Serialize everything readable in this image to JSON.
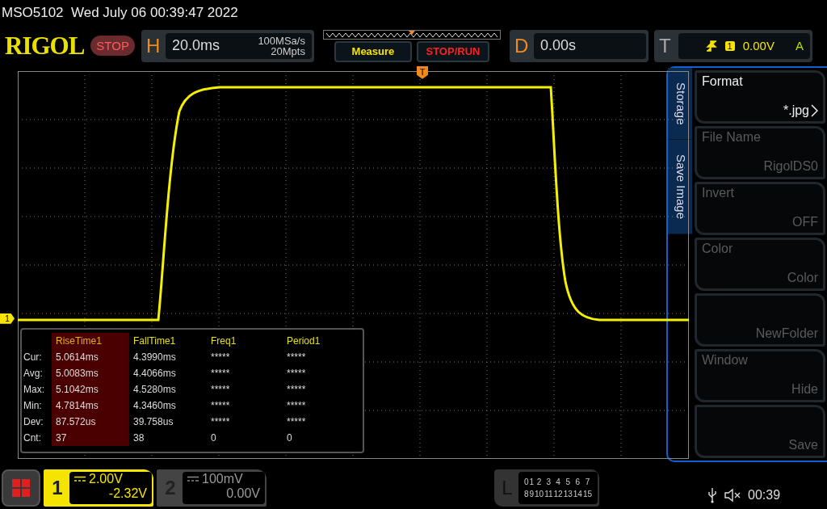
{
  "header": {
    "title": "MSO5102  Wed July 06 00:39:47 2022"
  },
  "toolbar": {
    "logo": "RIGOL",
    "run_state": "STOP",
    "horizontal": {
      "key": "H",
      "timebase": "20.0ms",
      "sample_rate": "100MSa/s",
      "memory_depth": "20Mpts"
    },
    "measure_button": "Measure",
    "stop_run_button": "STOP/RUN",
    "delay": {
      "key": "D",
      "value": "0.00s"
    },
    "trigger": {
      "key": "T",
      "source": "1",
      "level": "0.00V",
      "mode": "A"
    }
  },
  "display": {
    "trigger_marker": "T",
    "channel_marker": "1",
    "measurements": {
      "columns": [
        {
          "name": "RiseTime1",
          "selected": true
        },
        {
          "name": "FallTime1",
          "selected": false
        },
        {
          "name": "Freq1",
          "selected": false
        },
        {
          "name": "Period1",
          "selected": false
        }
      ],
      "rows": [
        {
          "label": "Cur:",
          "values": [
            "5.0614ms",
            "4.3990ms",
            "*****",
            "*****"
          ]
        },
        {
          "label": "Avg:",
          "values": [
            "5.0083ms",
            "4.4066ms",
            "*****",
            "*****"
          ]
        },
        {
          "label": "Max:",
          "values": [
            "5.1042ms",
            "4.5280ms",
            "*****",
            "*****"
          ]
        },
        {
          "label": "Min:",
          "values": [
            "4.7814ms",
            "4.3460ms",
            "*****",
            "*****"
          ]
        },
        {
          "label": "Dev:",
          "values": [
            "87.572us",
            "39.758us",
            "*****",
            "*****"
          ]
        },
        {
          "label": "Cnt:",
          "values": [
            "37",
            "38",
            "0",
            "0"
          ]
        }
      ]
    }
  },
  "side_tabs": [
    "Storage",
    "Save Image"
  ],
  "menu": [
    {
      "label": "Format",
      "value": "*.jpg",
      "enabled": true,
      "submenu": true
    },
    {
      "label": "File Name",
      "value": "RigolDS0",
      "enabled": false,
      "submenu": false
    },
    {
      "label": "Invert",
      "value": "OFF",
      "enabled": false,
      "submenu": false
    },
    {
      "label": "Color",
      "value": "Color",
      "enabled": false,
      "submenu": false
    },
    {
      "value": "NewFolder",
      "enabled": false,
      "submenu": false
    },
    {
      "label": "Window",
      "value": "Hide",
      "enabled": false,
      "submenu": false
    },
    {
      "value": "Save",
      "enabled": false,
      "submenu": false
    }
  ],
  "channels": [
    {
      "number": "1",
      "scale": "2.00V",
      "offset": "-2.32V",
      "active": true
    },
    {
      "number": "2",
      "scale": "100mV",
      "offset": "0.00V",
      "active": false
    }
  ],
  "logic": {
    "key": "L",
    "channels": [
      "0",
      "1",
      "2",
      "3",
      "4",
      "5",
      "6",
      "7",
      "8",
      "9",
      "10",
      "11",
      "12",
      "13",
      "14",
      "15"
    ]
  },
  "status": {
    "time": "00:39"
  }
}
